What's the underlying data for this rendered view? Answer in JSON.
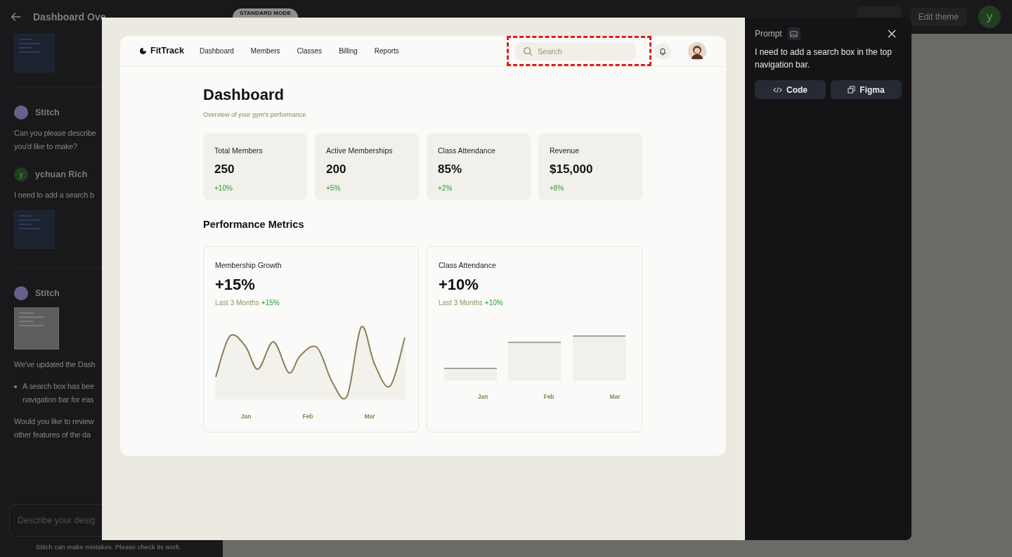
{
  "app_bar": {
    "title": "Dashboard Ove",
    "mode_badge": "STANDARD MODE",
    "edit_theme": "Edit theme",
    "user_initial": "y"
  },
  "chat": {
    "messages": [
      {
        "kind": "none",
        "blocks": [
          {
            "kind": "image"
          }
        ]
      },
      {
        "author": "Stitch",
        "kind": "bot",
        "blocks": [
          {
            "kind": "text",
            "lines": [
              "Can you please describe",
              "you'd like to make?"
            ]
          }
        ]
      },
      {
        "author": "ychuan Rich",
        "kind": "user",
        "initial": "y",
        "blocks": [
          {
            "kind": "text",
            "lines": [
              "I need to add a search b"
            ]
          },
          {
            "kind": "image"
          }
        ]
      },
      {
        "author": "Stitch",
        "kind": "bot",
        "blocks": [
          {
            "kind": "image"
          },
          {
            "kind": "text",
            "lines": [
              "We've updated the Dash"
            ]
          },
          {
            "kind": "bullet",
            "lines": [
              "A search box has bee",
              "navigation bar for eas"
            ]
          },
          {
            "kind": "text",
            "lines": [
              "Would you like to review",
              "other features of the da"
            ]
          }
        ]
      }
    ],
    "input_placeholder": "Describe your desig",
    "disclaimer": "Stitch can make mistakes. Please check its work."
  },
  "preview": {
    "brand": "FitTrack",
    "nav": [
      "Dashboard",
      "Members",
      "Classes",
      "Billing",
      "Reports"
    ],
    "search_placeholder": "Search",
    "highlighted": true,
    "title": "Dashboard",
    "subtitle": "Overview of your gym's performance",
    "stats": [
      {
        "label": "Total Members",
        "value": "250",
        "change": "+10%"
      },
      {
        "label": "Active Memberships",
        "value": "200",
        "change": "+5%"
      },
      {
        "label": "Class Attendance",
        "value": "85%",
        "change": "+2%"
      },
      {
        "label": "Revenue",
        "value": "$15,000",
        "change": "+8%"
      }
    ],
    "section_title": "Performance Metrics",
    "charts": [
      {
        "kind": "line",
        "title": "Membership Growth",
        "value": "+15%",
        "period": "Last 3 Months",
        "change": "+15%",
        "x_labels": [
          "Jan",
          "Feb",
          "Mar"
        ]
      },
      {
        "kind": "bar",
        "title": "Class Attendance",
        "value": "+10%",
        "period": "Last 3 Months",
        "change": "+10%",
        "x_labels": [
          "Jan",
          "Feb",
          "Mar"
        ]
      }
    ]
  },
  "prompt_panel": {
    "label": "Prompt",
    "text": "I need to add a search box in the top navigation bar.",
    "buttons": [
      {
        "kind": "code",
        "label": "Code"
      },
      {
        "kind": "figma",
        "label": "Figma"
      }
    ]
  }
}
